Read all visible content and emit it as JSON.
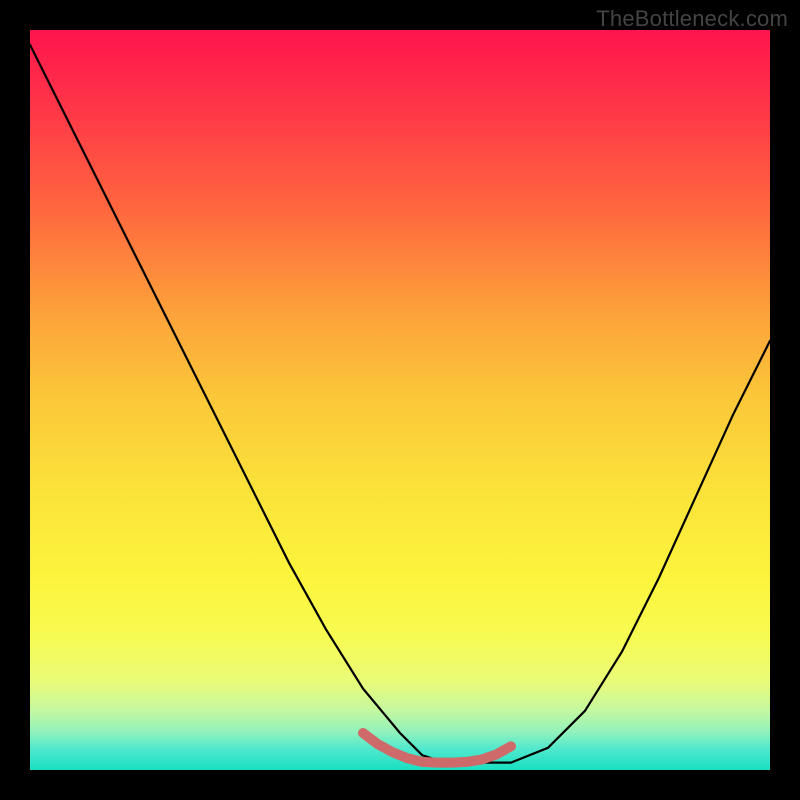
{
  "watermark": "TheBottleneck.com",
  "chart_data": {
    "type": "line",
    "title": "",
    "xlabel": "",
    "ylabel": "",
    "xlim": [
      0,
      100
    ],
    "ylim": [
      0,
      100
    ],
    "background_gradient": {
      "top": "#ff144d",
      "bottom": "#19dfc1",
      "direction": "vertical"
    },
    "series": [
      {
        "name": "bottleneck-curve",
        "color": "#000000",
        "x": [
          0,
          5,
          10,
          15,
          20,
          25,
          30,
          35,
          40,
          45,
          50,
          53,
          56,
          60,
          65,
          70,
          75,
          80,
          85,
          90,
          95,
          100
        ],
        "y": [
          98,
          88,
          78,
          68,
          58,
          48,
          38,
          28,
          19,
          11,
          5,
          2,
          1,
          1,
          1,
          3,
          8,
          16,
          26,
          37,
          48,
          58
        ]
      },
      {
        "name": "optimal-range-marker",
        "color": "#d06868",
        "x": [
          45,
          47,
          49,
          51,
          53,
          55,
          57,
          59,
          61,
          63,
          65
        ],
        "y": [
          5.0,
          3.5,
          2.4,
          1.6,
          1.1,
          1.0,
          1.0,
          1.1,
          1.4,
          2.1,
          3.2
        ]
      }
    ],
    "annotations": []
  }
}
